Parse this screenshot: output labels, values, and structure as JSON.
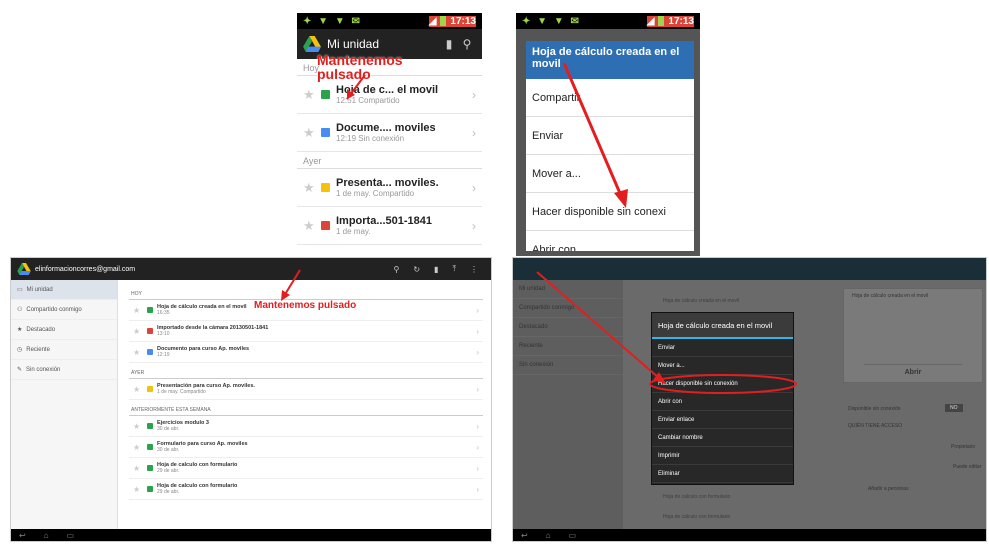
{
  "phone1": {
    "status_time": "17:13",
    "title": "Mi unidad",
    "annotation": "Mantenemos pulsado",
    "sections": [
      {
        "label": "Hoy",
        "rows": [
          {
            "name": "Hoja de c... el movil",
            "sub": "12:51  Compartido",
            "icon": "spreadsheet-icon"
          },
          {
            "name": "Docume.... moviles",
            "sub": "12:19  Sin conexión",
            "icon": "document-icon"
          }
        ]
      },
      {
        "label": "Ayer",
        "rows": [
          {
            "name": "Presenta... moviles.",
            "sub": "1 de may.  Compartido",
            "icon": "presentation-icon"
          },
          {
            "name": "Importa...501-1841",
            "sub": "1 de may.",
            "icon": "image-icon"
          }
        ]
      }
    ]
  },
  "phone2": {
    "status_time": "17:13",
    "menu_title": "Hoja de cálculo creada en el movil",
    "items": [
      "Compartir",
      "Enviar",
      "Mover a...",
      "Hacer disponible sin conexi",
      "Abrir con"
    ]
  },
  "tablet1": {
    "account": "elinformacioncorres@gmail.com",
    "annotation": "Mantenemos pulsado",
    "sidebar": [
      "Mi unidad",
      "Compartido conmigo",
      "Destacado",
      "Reciente",
      "Sin conexión"
    ],
    "sections": [
      {
        "label": "HOY",
        "rows": [
          {
            "name": "Hoja de cálculo creada en el movil",
            "sub": "16:35",
            "color": "g"
          },
          {
            "name": "Importado desde la cámara 20130501-1841",
            "sub": "13:10",
            "color": "r"
          },
          {
            "name": "Documento para curso Ap. moviles",
            "sub": "12:19",
            "color": "b"
          }
        ]
      },
      {
        "label": "AYER",
        "rows": [
          {
            "name": "Presentación para curso Ap. moviles.",
            "sub": "1 de may.  Compartido",
            "color": "y"
          }
        ]
      },
      {
        "label": "ANTERIORMENTE ESTA SEMANA",
        "rows": [
          {
            "name": "Ejercicios modulo 3",
            "sub": "30 de abr.",
            "color": "g"
          },
          {
            "name": "Formulario para curso Ap. moviles",
            "sub": "30 de abr.",
            "color": "g"
          },
          {
            "name": "Hoja de calculo con formulario",
            "sub": "29 de abr.",
            "color": "g"
          },
          {
            "name": "Hoja de calculo con formulario",
            "sub": "29 de abr.",
            "color": "g"
          }
        ]
      }
    ]
  },
  "tablet2": {
    "dialog_title": "Hoja de cálculo creada en el movil",
    "items": [
      "Enviar",
      "Mover a...",
      "Hacer disponible sin conexión",
      "Abrir con",
      "Enviar enlace",
      "Cambiar nombre",
      "Imprimir",
      "Eliminar"
    ],
    "highlighted_index": 2,
    "bg_sidebar": [
      "Mi unidad",
      "Compartido conmigo",
      "Destacado",
      "Reciente",
      "Sin conexión"
    ],
    "bg_rows": [
      "Hoja de cálculo creada en el movil",
      "Hoja de calculo con formulario",
      "Hoja de calculo con formulario"
    ],
    "bg_right": {
      "preview_title": "Hoja de cálculo creada en el movil",
      "open_button": "Abrir",
      "offline_label": "Disponible sin conexión",
      "toggle": "NO",
      "access_label": "QUIÉN TIENE ACCESO",
      "owner": "Propietario",
      "editor": "Puede editar",
      "add_people": "Añadir a personas"
    }
  }
}
